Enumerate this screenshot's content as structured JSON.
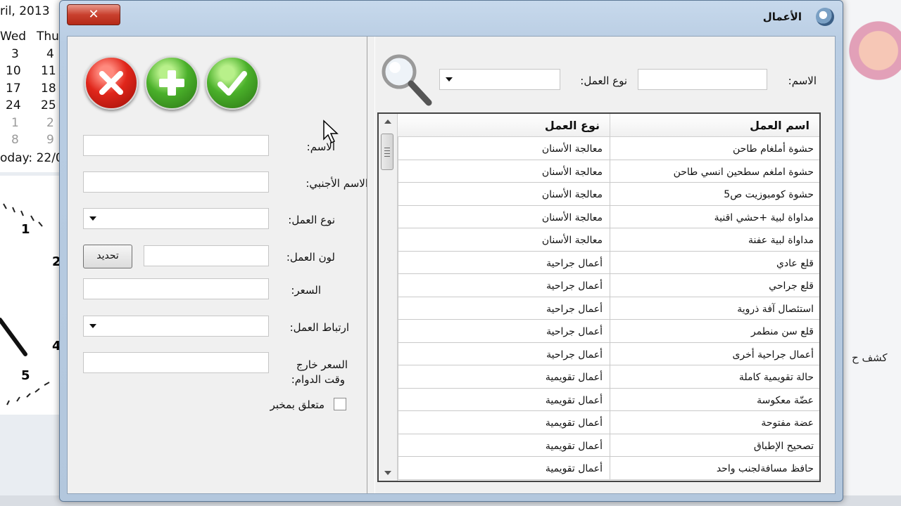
{
  "desktop": {
    "calendar": {
      "month_text": "ril, 2013",
      "day_headers": [
        "Wed",
        "Thu"
      ],
      "rows": [
        [
          "3",
          "4"
        ],
        [
          "10",
          "11"
        ],
        [
          "17",
          "18"
        ],
        [
          "24",
          "25"
        ],
        [
          "1",
          "2"
        ],
        [
          "8",
          "9"
        ]
      ],
      "today_text": "oday: 22/0"
    },
    "clock_numbers": [
      "1",
      "2",
      "4",
      "5"
    ],
    "right_text": "كشف ح"
  },
  "window": {
    "title": "الأعمال",
    "close_label": "✕"
  },
  "form": {
    "name_label": "الاسم:",
    "name_value": "",
    "foreign_name_label": "الاسم الأجنبي:",
    "foreign_name_value": "",
    "work_type_label": "نوع العمل:",
    "work_type_value": "",
    "work_color_label": "لون العمل:",
    "work_color_value": "",
    "update_button_label": "تحديد",
    "price_label": "السعر:",
    "price_value": "",
    "work_link_label": "ارتباط العمل:",
    "work_link_value": "",
    "after_hours_price_label_line1": "السعر خارج",
    "after_hours_price_label_line2": "وقت الدوام:",
    "after_hours_price_value": "",
    "lab_checkbox_label": "متعلق بمخبر",
    "lab_checked": false
  },
  "search": {
    "name_label": "الاسم:",
    "name_value": "",
    "work_type_label": "نوع العمل:",
    "work_type_value": ""
  },
  "table": {
    "headers": {
      "name": "اسم العمل",
      "type": "نوع العمل"
    },
    "rows": [
      {
        "name": "حشوة أملغام طاحن",
        "type": "معالجة الأسنان"
      },
      {
        "name": "حشوة املغم سطحين انسي طاحن",
        "type": "معالجة الأسنان"
      },
      {
        "name": "حشوة كومبوزيت ص5",
        "type": "معالجة الأسنان"
      },
      {
        "name": "مداواة لبية +حشي اقنية",
        "type": "معالجة الأسنان"
      },
      {
        "name": "مداواة لبية عفنة",
        "type": "معالجة الأسنان"
      },
      {
        "name": "قلع عادي",
        "type": "أعمال جراحية"
      },
      {
        "name": "قلع جراحي",
        "type": "أعمال جراحية"
      },
      {
        "name": "استئصال آفة ذروية",
        "type": "أعمال جراحية"
      },
      {
        "name": "قلع سن منطمر",
        "type": "أعمال جراحية"
      },
      {
        "name": "أعمال جراحية أخرى",
        "type": "أعمال جراحية"
      },
      {
        "name": "حالة تقويمية كاملة",
        "type": "أعمال تقويمية"
      },
      {
        "name": "عضّة معكوسة",
        "type": "أعمال تقويمية"
      },
      {
        "name": "عضة مفتوحة",
        "type": "أعمال تقويمية"
      },
      {
        "name": "تصحيح الإطباق",
        "type": "أعمال تقويمية"
      },
      {
        "name": "حافظ مسافةلجنب واحد",
        "type": "أعمال تقويمية"
      }
    ]
  },
  "colors": {
    "close": "#c9402e",
    "cancel": "#e0261b",
    "add": "#4ab02a",
    "ok": "#4ab02a"
  },
  "icons": [
    "close-icon",
    "cancel-icon",
    "add-icon",
    "check-icon",
    "search-icon",
    "dropdown-arrow-icon",
    "scroll-up-icon",
    "scroll-down-icon",
    "cursor-icon",
    "window-app-icon"
  ]
}
